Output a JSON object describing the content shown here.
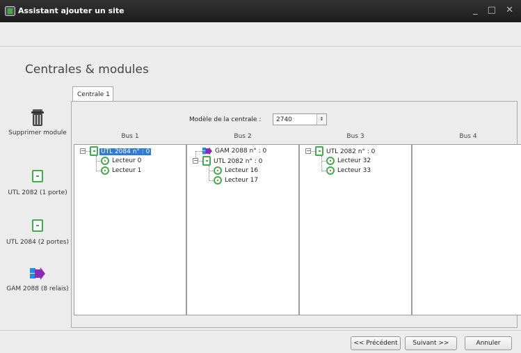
{
  "window": {
    "title": "Assistant ajouter un site",
    "controls": "_ □ ✕"
  },
  "page": {
    "heading": "Centrales & modules"
  },
  "tabs": [
    {
      "label": "Centrale 1"
    }
  ],
  "toolbox": {
    "delete": "Supprimer module",
    "utl2082": "UTL 2082 (1 porte)",
    "utl2084": "UTL 2084 (2 portes)",
    "gam2088": "GAM 2088 (8 relais)"
  },
  "model": {
    "label": "Modèle de la centrale :",
    "value": "2740",
    "spin": "⇕"
  },
  "buses": [
    {
      "name": "Bus 1",
      "items": [
        {
          "label": "UTL 2084 n° : 0",
          "selected": true
        },
        {
          "label": "Lecteur 0"
        },
        {
          "label": "Lecteur 1"
        }
      ]
    },
    {
      "name": "Bus 2",
      "items": [
        {
          "label": "GAM 2088 n° : 0"
        },
        {
          "label": "UTL 2082 n° : 0"
        },
        {
          "label": "Lecteur 16"
        },
        {
          "label": "Lecteur 17"
        }
      ]
    },
    {
      "name": "Bus 3",
      "items": [
        {
          "label": "UTL 2082 n° : 0"
        },
        {
          "label": "Lecteur 32"
        },
        {
          "label": "Lecteur 33"
        }
      ]
    },
    {
      "name": "Bus 4",
      "items": []
    }
  ],
  "buttons": {
    "previous": "<< Précédent",
    "next": "Suivant >>",
    "cancel": "Annuler"
  },
  "colors": {
    "accent": "#2f7bd8",
    "module_green": "#3fae48",
    "gam_blue": "#1f8ee6",
    "gam_purple": "#8e2ab8"
  }
}
